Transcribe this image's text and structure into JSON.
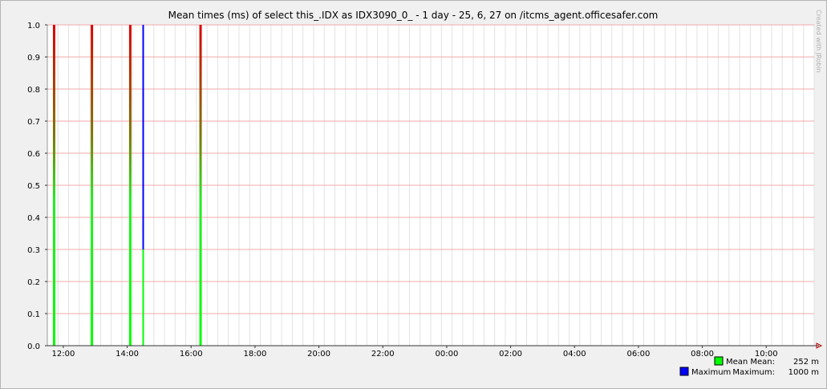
{
  "chart_data": {
    "type": "bar",
    "title": "Mean times (ms) of select this_.IDX as IDX3090_0_ - 1 day - 25, 6, 27 on /itcms_agent.officesafer.com",
    "watermark": "Created with JRobin",
    "xlabel": "",
    "ylabel": "",
    "ylim": [
      0,
      1.0
    ],
    "yticks": [
      "0.0",
      "0.1",
      "0.2",
      "0.3",
      "0.4",
      "0.5",
      "0.6",
      "0.7",
      "0.8",
      "0.9",
      "1.0"
    ],
    "xlim": [
      "11:30",
      "11:30 (+1 day)"
    ],
    "xticks": [
      "12:00",
      "14:00",
      "16:00",
      "18:00",
      "20:00",
      "22:00",
      "00:00",
      "02:00",
      "04:00",
      "06:00",
      "08:00",
      "10:00"
    ],
    "grid": true,
    "legend_position": "bottom-right",
    "colors": {
      "mean": "#00ff00",
      "mean_top": "#dd0000",
      "maximum": "#0000ff",
      "grid_major": "#f2a8a8",
      "grid_minor": "#e2e2e2",
      "axis": "#c00000"
    },
    "series": [
      {
        "name": "Mean",
        "x": [
          "11:42",
          "12:53",
          "14:05",
          "14:30",
          "16:17"
        ],
        "values": [
          1.0,
          1.0,
          1.0,
          0.3,
          1.0
        ]
      },
      {
        "name": "Maximum",
        "x": [
          "11:42",
          "12:53",
          "14:05",
          "14:30",
          "16:17"
        ],
        "values": [
          1.0,
          1.0,
          1.0,
          1.0,
          1.0
        ]
      }
    ],
    "legend": [
      {
        "name": "Mean",
        "stat_label": "Mean:",
        "stat_value": "252 m",
        "color": "#00ff00"
      },
      {
        "name": "Maximum",
        "stat_label": "Maximum:",
        "stat_value": "1000 m",
        "color": "#0000ff"
      }
    ]
  }
}
